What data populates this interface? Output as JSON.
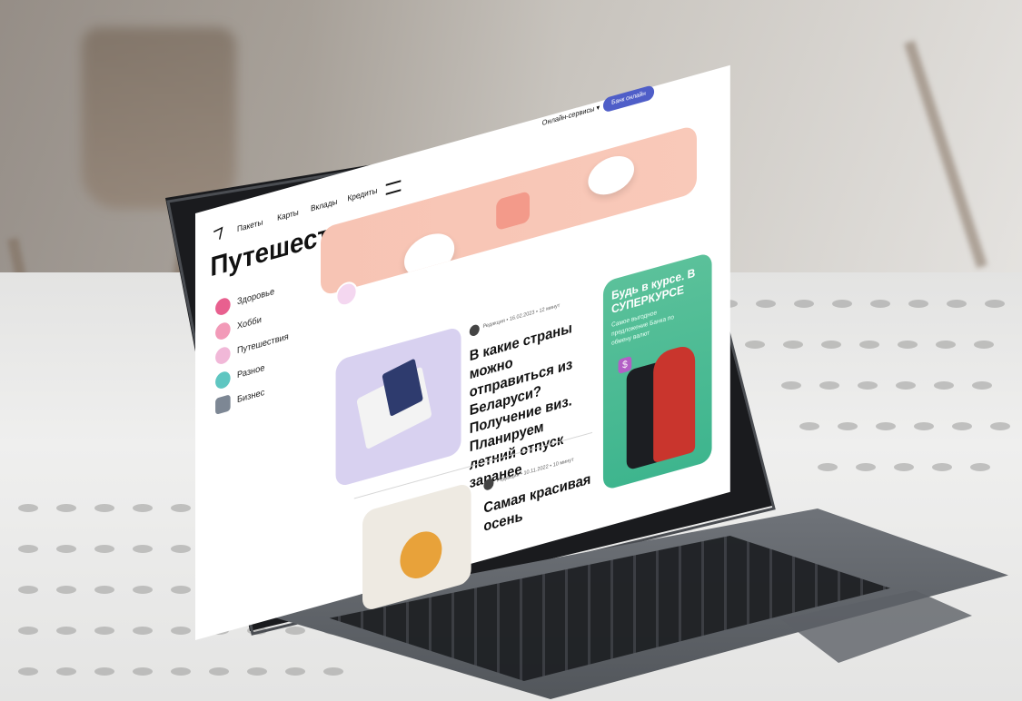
{
  "nav": {
    "items": [
      "Пакеты",
      "Карты",
      "Вклады",
      "Кредиты"
    ],
    "online_services": "Онлайн-сервисы",
    "bank_online": "Банк онлайн"
  },
  "page": {
    "title": "Путешествия"
  },
  "categories": [
    {
      "label": "Здоровье",
      "color": "#e8608f"
    },
    {
      "label": "Хобби",
      "color": "#f29ab8"
    },
    {
      "label": "Путешествия",
      "color": "#f1b8d8"
    },
    {
      "label": "Разное",
      "color": "#5fc6c1"
    },
    {
      "label": "Бизнес",
      "color": "#7d8794"
    }
  ],
  "articles": [
    {
      "author": "Редакция",
      "date": "16.02.2023",
      "read_time": "12 минут",
      "title": "В какие страны можно отправиться из Беларуси? Получение виз. Планируем летний отпуск заранее",
      "thumb_color": "#d8d1f0"
    },
    {
      "author": "Редакция",
      "date": "10.11.2022",
      "read_time": "10 минут",
      "title": "Самая красивая осень",
      "thumb_color": "#eeeae2"
    }
  ],
  "promo": {
    "title": "Будь в курсе. В СУПЕРКУРСЕ",
    "subtitle": "Самое выгодное предложение Банка по обмену валют",
    "color": "#46b98f"
  },
  "colors": {
    "accent": "#4f5ec8",
    "hero": "#f8c6b6"
  }
}
